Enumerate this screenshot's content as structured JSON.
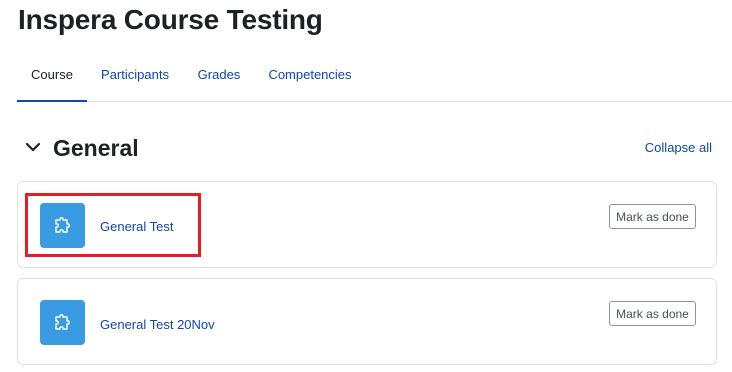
{
  "course": {
    "title": "Inspera Course Testing"
  },
  "tabs": [
    {
      "label": "Course",
      "active": true
    },
    {
      "label": "Participants",
      "active": false
    },
    {
      "label": "Grades",
      "active": false
    },
    {
      "label": "Competencies",
      "active": false
    }
  ],
  "section": {
    "title": "General",
    "collapse_label": "Collapse all",
    "toggle_icon": "chevron-down-icon"
  },
  "activities": [
    {
      "name": "General Test",
      "icon": "puzzle-piece-icon",
      "action_label": "Mark as done",
      "highlighted": true
    },
    {
      "name": "General Test 20Nov",
      "icon": "puzzle-piece-icon",
      "action_label": "Mark as done",
      "highlighted": false
    }
  ],
  "colors": {
    "link": "#0f47ad",
    "activity_icon_bg": "#399be2",
    "highlight": "#e31e24"
  }
}
